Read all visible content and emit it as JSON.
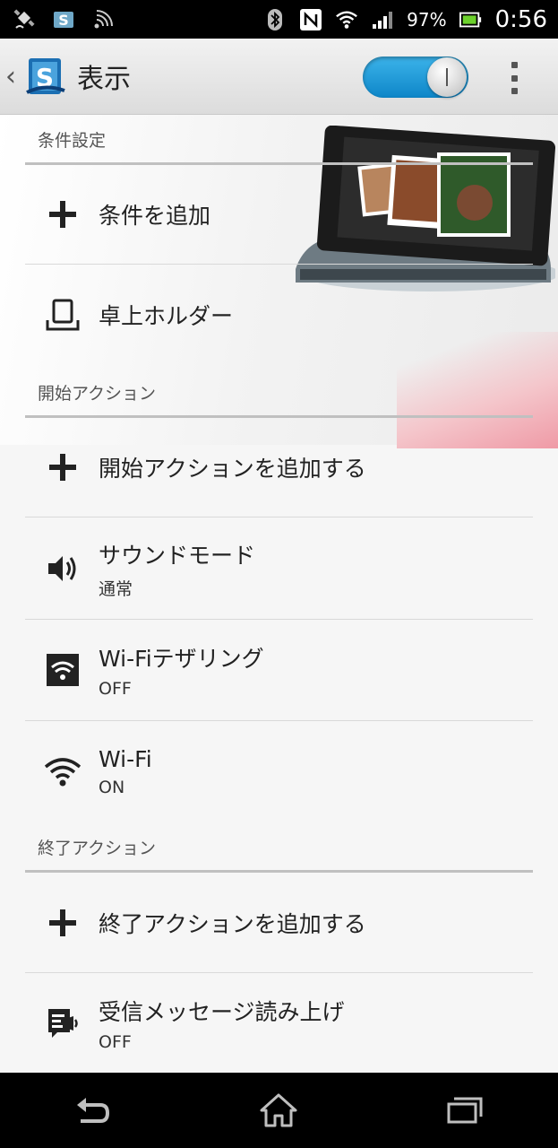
{
  "status_bar": {
    "battery_percent": "97%",
    "time": "0:56",
    "icons": [
      "satellite-icon",
      "app-s-icon",
      "signal-broadcast-icon",
      "bluetooth-icon",
      "nfc-icon",
      "wifi-icon",
      "cell-signal-icon",
      "battery-icon"
    ]
  },
  "action_bar": {
    "title": "表示",
    "toggle_state": "on",
    "accent_color": "#1a9ad6"
  },
  "sections": {
    "conditions": {
      "header": "条件設定",
      "add_label": "条件を追加",
      "items": [
        {
          "label": "卓上ホルダー",
          "icon": "desk-holder-icon"
        }
      ]
    },
    "start_actions": {
      "header": "開始アクション",
      "add_label": "開始アクションを追加する",
      "items": [
        {
          "label": "サウンドモード",
          "sub": "通常",
          "icon": "speaker-icon"
        },
        {
          "label": "Wi-Fiテザリング",
          "sub": "OFF",
          "icon": "wifi-tethering-icon"
        },
        {
          "label": "Wi-Fi",
          "sub": "ON",
          "icon": "wifi-icon"
        }
      ]
    },
    "end_actions": {
      "header": "終了アクション",
      "add_label": "終了アクションを追加する",
      "items": [
        {
          "label": "受信メッセージ読み上げ",
          "sub": "OFF",
          "icon": "message-readout-icon"
        }
      ]
    }
  },
  "nav_bar": {
    "buttons": [
      "back-icon",
      "home-icon",
      "recent-apps-icon"
    ]
  }
}
